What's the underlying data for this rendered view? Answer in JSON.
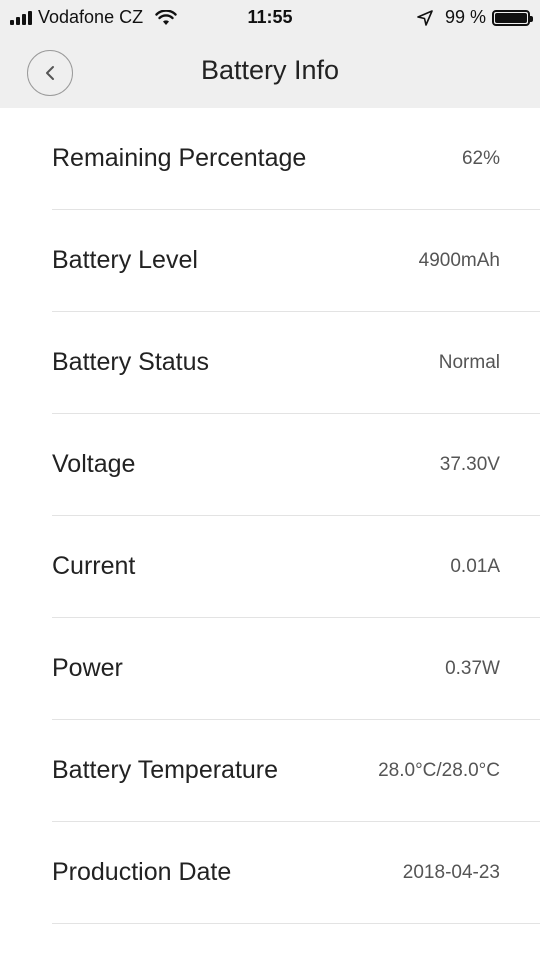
{
  "status_bar": {
    "carrier": "Vodafone CZ",
    "time": "11:55",
    "battery_percent": "99 %",
    "battery_level": 0.99,
    "signal_icon": "signal-bars-icon",
    "wifi_icon": "wifi-icon",
    "location_icon": "location-arrow-icon",
    "battery_icon": "battery-icon"
  },
  "header": {
    "title": "Battery Info",
    "back_icon": "chevron-left-icon"
  },
  "rows": [
    {
      "label": "Remaining Percentage",
      "value": "62%"
    },
    {
      "label": "Battery Level",
      "value": "4900mAh"
    },
    {
      "label": "Battery Status",
      "value": "Normal"
    },
    {
      "label": "Voltage",
      "value": "37.30V"
    },
    {
      "label": "Current",
      "value": "0.01A"
    },
    {
      "label": "Power",
      "value": "0.37W"
    },
    {
      "label": "Battery Temperature",
      "value": "28.0°C/28.0°C"
    },
    {
      "label": "Production Date",
      "value": "2018-04-23"
    }
  ],
  "colors": {
    "header_background": "#efefef",
    "page_background": "#ffffff",
    "divider": "#e3e3e3"
  }
}
